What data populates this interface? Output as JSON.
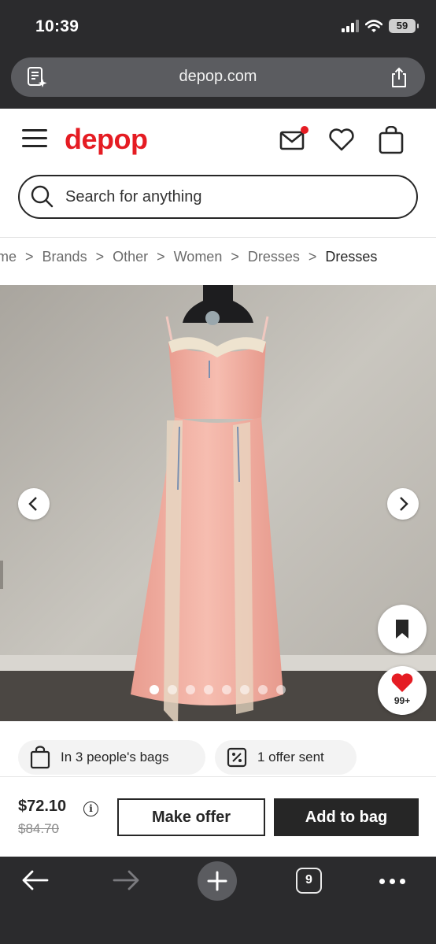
{
  "status": {
    "time": "10:39",
    "battery": "59"
  },
  "browser": {
    "url": "depop.com",
    "tab_count": "9"
  },
  "header": {
    "logo": "depop"
  },
  "search": {
    "placeholder": "Search for anything"
  },
  "breadcrumb": [
    "ome",
    "Brands",
    "Other",
    "Women",
    "Dresses",
    "Dresses"
  ],
  "gallery": {
    "dot_count": 8,
    "active_dot": 0
  },
  "likes": {
    "count": "99+"
  },
  "pills": {
    "bags": "In 3 people's bags",
    "offers": "1 offer sent"
  },
  "purchase": {
    "price": "$72.10",
    "original_price": "$84.70",
    "make_offer": "Make offer",
    "add_to_bag": "Add to bag"
  },
  "colors": {
    "brand": "#e51c23",
    "dark": "#262626",
    "dress": "#f2b3a6"
  }
}
